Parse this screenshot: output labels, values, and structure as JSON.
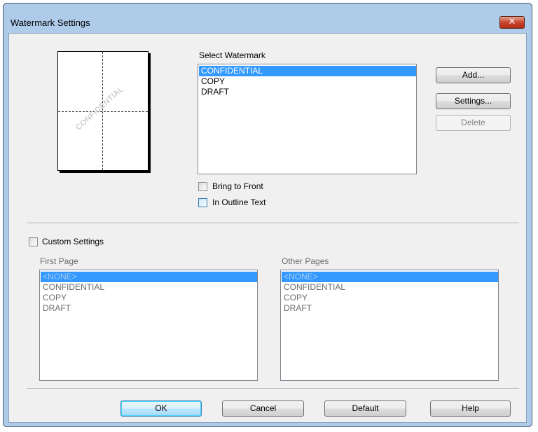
{
  "window": {
    "title": "Watermark Settings",
    "close_glyph": "✕"
  },
  "preview": {
    "watermark_text": "CONFIDENTIAL"
  },
  "select_watermark": {
    "label": "Select Watermark",
    "items": [
      "CONFIDENTIAL",
      "COPY",
      "DRAFT"
    ],
    "selected": "CONFIDENTIAL"
  },
  "buttons": {
    "add": "Add...",
    "settings": "Settings...",
    "delete": "Delete"
  },
  "checkboxes": {
    "bring_to_front": "Bring to Front",
    "in_outline_text": "In Outline Text",
    "custom_settings": "Custom Settings"
  },
  "first_page": {
    "label": "First Page",
    "items": [
      "<NONE>",
      "CONFIDENTIAL",
      "COPY",
      "DRAFT"
    ],
    "selected": "<NONE>"
  },
  "other_pages": {
    "label": "Other Pages",
    "items": [
      "<NONE>",
      "CONFIDENTIAL",
      "COPY",
      "DRAFT"
    ],
    "selected": "<NONE>"
  },
  "footer": {
    "ok": "OK",
    "cancel": "Cancel",
    "default": "Default",
    "help": "Help"
  },
  "colors": {
    "selection": "#3399ff",
    "titlebar": "#aecbea",
    "close": "#c8442c"
  }
}
